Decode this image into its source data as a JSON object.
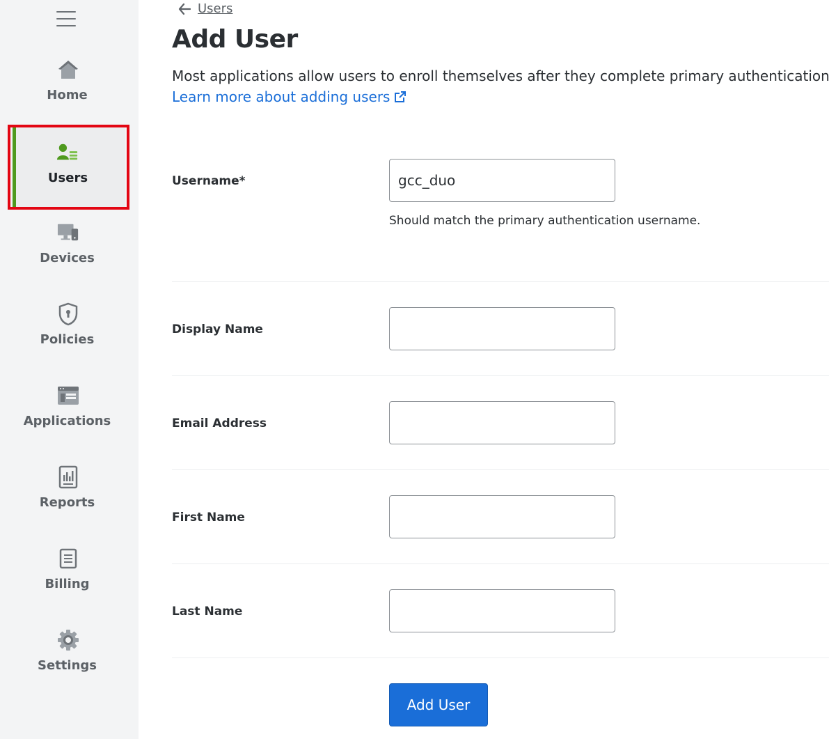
{
  "sidebar": {
    "items": [
      {
        "label": "Home",
        "icon": "home-icon"
      },
      {
        "label": "Users",
        "icon": "users-icon",
        "active": true
      },
      {
        "label": "Devices",
        "icon": "devices-icon"
      },
      {
        "label": "Policies",
        "icon": "shield-icon"
      },
      {
        "label": "Applications",
        "icon": "applications-icon"
      },
      {
        "label": "Reports",
        "icon": "reports-icon"
      },
      {
        "label": "Billing",
        "icon": "billing-icon"
      },
      {
        "label": "Settings",
        "icon": "gear-icon"
      }
    ]
  },
  "breadcrumb": {
    "label": "Users"
  },
  "page": {
    "title": "Add User",
    "intro": "Most applications allow users to enroll themselves after they complete primary authentication.",
    "learn_more": "Learn more about adding users"
  },
  "form": {
    "username": {
      "label": "Username*",
      "value": "gcc_duo",
      "hint": "Should match the primary authentication username."
    },
    "display_name": {
      "label": "Display Name",
      "value": ""
    },
    "email": {
      "label": "Email Address",
      "value": ""
    },
    "first_name": {
      "label": "First Name",
      "value": ""
    },
    "last_name": {
      "label": "Last Name",
      "value": ""
    },
    "submit_label": "Add User"
  },
  "colors": {
    "accent": "#1a6ed8",
    "active_nav": "#4f9a1e",
    "highlight": "#e30613"
  }
}
